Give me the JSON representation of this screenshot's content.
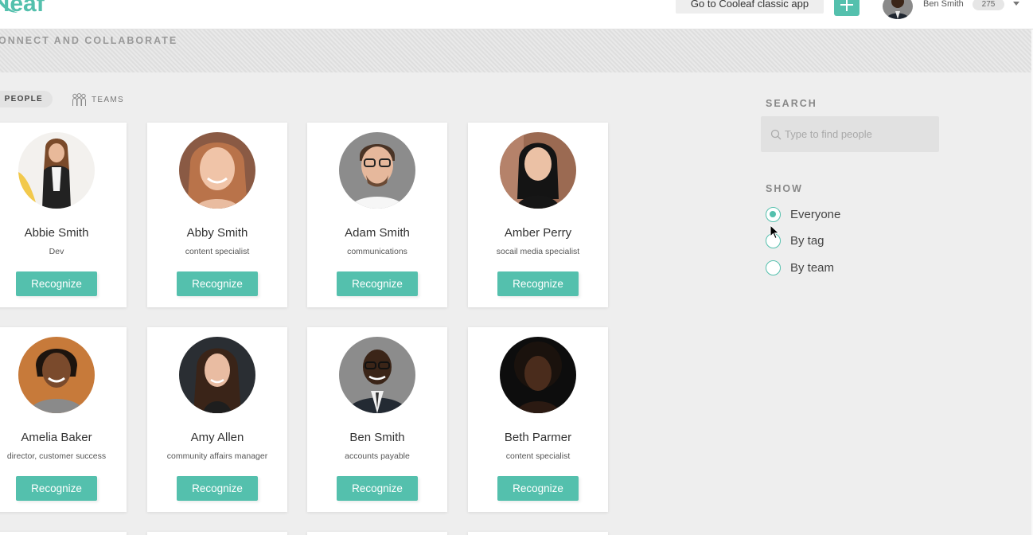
{
  "topbar": {
    "logo_text": "leaf",
    "classic_label": "Go to Cooleaf classic app",
    "user_name": "Ben Smith",
    "points": "275"
  },
  "page": {
    "title": "ONNECT AND COLLABORATE"
  },
  "tabs": {
    "people": "PEOPLE",
    "teams": "TEAMS"
  },
  "people": [
    {
      "name": "Abbie Smith",
      "role": "Dev",
      "button": "Recognize"
    },
    {
      "name": "Abby Smith",
      "role": "content specialist",
      "button": "Recognize"
    },
    {
      "name": "Adam Smith",
      "role": "communications",
      "button": "Recognize"
    },
    {
      "name": "Amber Perry",
      "role": "socail media specialist",
      "button": "Recognize"
    },
    {
      "name": "Amelia Baker",
      "role": "director, customer success",
      "button": "Recognize"
    },
    {
      "name": "Amy Allen",
      "role": "community affairs manager",
      "button": "Recognize"
    },
    {
      "name": "Ben Smith",
      "role": "accounts payable",
      "button": "Recognize"
    },
    {
      "name": "Beth Parmer",
      "role": "content specialist",
      "button": "Recognize"
    }
  ],
  "sidebar": {
    "search_label": "SEARCH",
    "search_placeholder": "Type to find people",
    "show_label": "SHOW",
    "options": [
      {
        "label": "Everyone",
        "selected": true
      },
      {
        "label": "By tag",
        "selected": false
      },
      {
        "label": "By team",
        "selected": false
      }
    ]
  },
  "colors": {
    "accent": "#54c0ad"
  }
}
